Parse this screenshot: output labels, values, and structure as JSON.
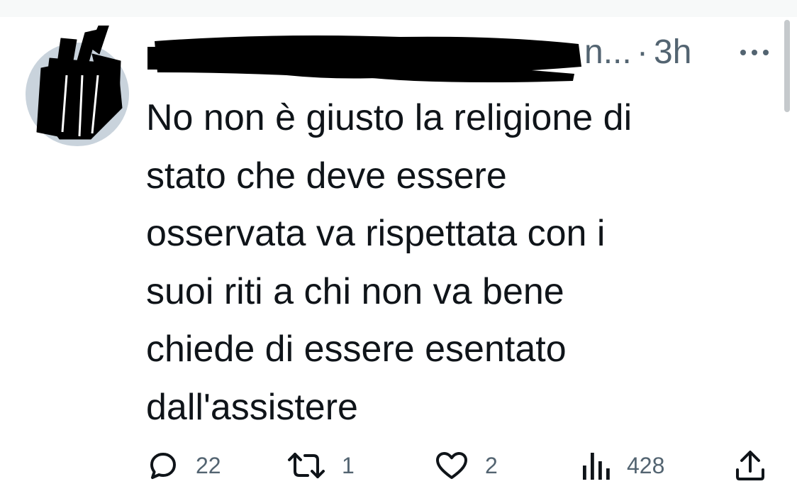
{
  "tweet": {
    "handle_tail": "n...",
    "dot": "·",
    "time": "3h",
    "text": "No non è giusto la religione di\nstato che deve essere\nosservata va rispettata con i\nsuoi riti a chi non va bene\nchiede di essere esentato\ndall'assistere"
  },
  "actions": {
    "replies": "22",
    "retweets": "1",
    "likes": "2",
    "views": "428"
  },
  "icons": {
    "reply": "reply-icon",
    "retweet": "retweet-icon",
    "like": "heart-icon",
    "views": "views-icon",
    "share": "share-icon",
    "more": "more-icon"
  },
  "colors": {
    "text": "#0f1419",
    "secondary": "#536471",
    "redaction": "#000000"
  }
}
